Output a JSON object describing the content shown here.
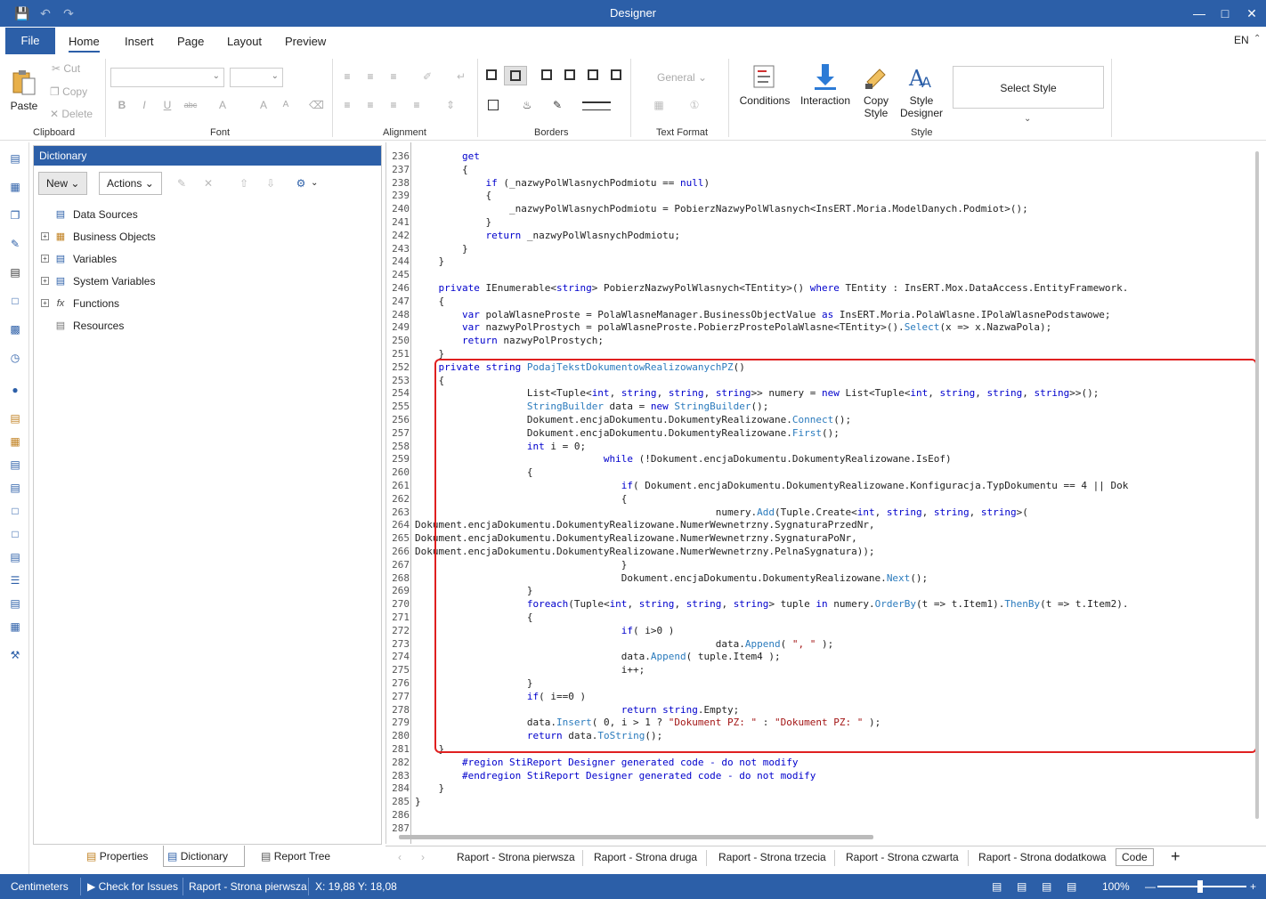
{
  "window": {
    "title": "Designer"
  },
  "menu": {
    "file": "File",
    "tabs": [
      "Home",
      "Insert",
      "Page",
      "Layout",
      "Preview"
    ],
    "lang": "EN"
  },
  "ribbon": {
    "clipboard": {
      "label": "Clipboard",
      "paste": "Paste",
      "cut": "Cut",
      "copy": "Copy",
      "delete": "Delete"
    },
    "font": {
      "label": "Font"
    },
    "alignment": {
      "label": "Alignment"
    },
    "borders": {
      "label": "Borders"
    },
    "text_format": {
      "label": "Text Format",
      "general": "General"
    },
    "style": {
      "label": "Style",
      "conditions": "Conditions",
      "interaction": "Interaction",
      "copy_style_1": "Copy",
      "copy_style_2": "Style",
      "style_designer_1": "Style",
      "style_designer_2": "Designer",
      "select_style": "Select Style"
    }
  },
  "dictionary": {
    "title": "Dictionary",
    "new_btn": "New",
    "actions_btn": "Actions",
    "tree": [
      {
        "label": "Data Sources",
        "expandable": false
      },
      {
        "label": "Business Objects",
        "expandable": true
      },
      {
        "label": "Variables",
        "expandable": true
      },
      {
        "label": "System Variables",
        "expandable": true
      },
      {
        "label": "Functions",
        "expandable": true
      },
      {
        "label": "Resources",
        "expandable": false
      }
    ]
  },
  "bottom_tabs": [
    "Properties",
    "Dictionary",
    "Report Tree"
  ],
  "code": {
    "lines": [
      {
        "n": "236",
        "t": "        get"
      },
      {
        "n": "237",
        "t": "        {"
      },
      {
        "n": "238",
        "t": "            if (_nazwyPolWlasnychPodmiotu == null)"
      },
      {
        "n": "239",
        "t": "            {"
      },
      {
        "n": "240",
        "t": "                _nazwyPolWlasnychPodmiotu = PobierzNazwyPolWlasnych<InsERT.Moria.ModelDanych.Podmiot>();"
      },
      {
        "n": "241",
        "t": "            }"
      },
      {
        "n": "242",
        "t": "            return _nazwyPolWlasnychPodmiotu;"
      },
      {
        "n": "243",
        "t": "        }"
      },
      {
        "n": "244",
        "t": "    }"
      },
      {
        "n": "245",
        "t": ""
      },
      {
        "n": "246",
        "t": "    private IEnumerable<string> PobierzNazwyPolWlasnych<TEntity>() where TEntity : InsERT.Mox.DataAccess.EntityFramework."
      },
      {
        "n": "247",
        "t": "    {"
      },
      {
        "n": "248",
        "t": "        var polaWlasneProste = PolaWlasneManager.BusinessObjectValue as InsERT.Moria.PolaWlasne.IPolaWlasnePodstawowe;"
      },
      {
        "n": "249",
        "t": "        var nazwyPolProstych = polaWlasneProste.PobierzProstePolaWlasne<TEntity>().Select(x => x.NazwaPola);"
      },
      {
        "n": "250",
        "t": "        return nazwyPolProstych;"
      },
      {
        "n": "251",
        "t": "    }"
      },
      {
        "n": "252",
        "t": "    private string PodajTekstDokumentowRealizowanychPZ()"
      },
      {
        "n": "253",
        "t": "    {"
      },
      {
        "n": "254",
        "t": "                   List<Tuple<int, string, string, string>> numery = new List<Tuple<int, string, string, string>>();"
      },
      {
        "n": "255",
        "t": "                   StringBuilder data = new StringBuilder();"
      },
      {
        "n": "256",
        "t": "                   Dokument.encjaDokumentu.DokumentyRealizowane.Connect();"
      },
      {
        "n": "257",
        "t": "                   Dokument.encjaDokumentu.DokumentyRealizowane.First();"
      },
      {
        "n": "258",
        "t": "                   int i = 0;"
      },
      {
        "n": "259",
        "t": "                                while (!Dokument.encjaDokumentu.DokumentyRealizowane.IsEof)"
      },
      {
        "n": "260",
        "t": "                   {"
      },
      {
        "n": "261",
        "t": "                                   if( Dokument.encjaDokumentu.DokumentyRealizowane.Konfiguracja.TypDokumentu == 4 || Dok"
      },
      {
        "n": "262",
        "t": "                                   {"
      },
      {
        "n": "263",
        "t": "                                                   numery.Add(Tuple.Create<int, string, string, string>("
      },
      {
        "n": "264",
        "t": "Dokument.encjaDokumentu.DokumentyRealizowane.NumerWewnetrzny.SygnaturaPrzedNr,"
      },
      {
        "n": "265",
        "t": "Dokument.encjaDokumentu.DokumentyRealizowane.NumerWewnetrzny.SygnaturaPoNr,"
      },
      {
        "n": "266",
        "t": "Dokument.encjaDokumentu.DokumentyRealizowane.NumerWewnetrzny.PelnaSygnatura));"
      },
      {
        "n": "267",
        "t": "                                   }"
      },
      {
        "n": "268",
        "t": "                                   Dokument.encjaDokumentu.DokumentyRealizowane.Next();"
      },
      {
        "n": "269",
        "t": "                   }"
      },
      {
        "n": "270",
        "t": "                   foreach(Tuple<int, string, string, string> tuple in numery.OrderBy(t => t.Item1).ThenBy(t => t.Item2)."
      },
      {
        "n": "271",
        "t": "                   {"
      },
      {
        "n": "272",
        "t": "                                   if( i>0 )"
      },
      {
        "n": "273",
        "t": "                                                   data.Append( \", \" );"
      },
      {
        "n": "274",
        "t": "                                   data.Append( tuple.Item4 );"
      },
      {
        "n": "275",
        "t": "                                   i++;"
      },
      {
        "n": "276",
        "t": "                   }"
      },
      {
        "n": "277",
        "t": "                   if( i==0 )"
      },
      {
        "n": "278",
        "t": "                                   return string.Empty;"
      },
      {
        "n": "279",
        "t": "                   data.Insert( 0, i > 1 ? \"Dokument PZ: \" : \"Dokument PZ: \" );"
      },
      {
        "n": "280",
        "t": "                   return data.ToString();"
      },
      {
        "n": "281",
        "t": "    }"
      },
      {
        "n": "282",
        "t": "        #region StiReport Designer generated code - do not modify"
      },
      {
        "n": "283",
        "t": "        #endregion StiReport Designer generated code - do not modify"
      },
      {
        "n": "284",
        "t": "    }"
      },
      {
        "n": "285",
        "t": "}"
      },
      {
        "n": "286",
        "t": ""
      },
      {
        "n": "287",
        "t": ""
      }
    ]
  },
  "page_tabs": [
    "Raport - Strona pierwsza",
    "Raport - Strona druga",
    "Raport - Strona trzecia",
    "Raport - Strona czwarta",
    "Raport - Strona dodatkowa",
    "Code"
  ],
  "status": {
    "units": "Centimeters",
    "check": "Check for Issues",
    "page": "Raport - Strona pierwsza",
    "coords": "X: 19,88 Y: 18,08",
    "zoom": "100%"
  }
}
